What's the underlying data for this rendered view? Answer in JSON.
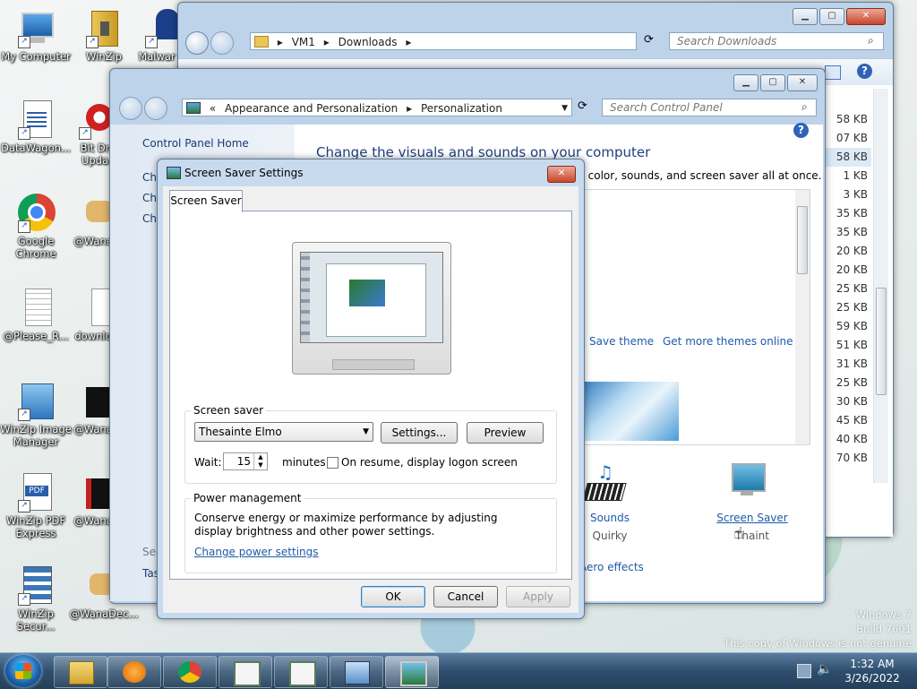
{
  "desktop": {
    "icons": [
      {
        "label": "My Computer"
      },
      {
        "label": "WinZip"
      },
      {
        "label": "Malwar"
      },
      {
        "label": "DataWagon..."
      },
      {
        "label": "Bit Dr Upda"
      },
      {
        "label": "Google Chrome"
      },
      {
        "label": "@Wana"
      },
      {
        "label": "@Please_R..."
      },
      {
        "label": "downlo"
      },
      {
        "label": "WinZip Image Manager"
      },
      {
        "label": "@Wana"
      },
      {
        "label": "WinZip PDF Express"
      },
      {
        "label": "@Wana"
      },
      {
        "label": "WinZip Secur..."
      },
      {
        "label": "@WanaDec..."
      }
    ],
    "watermark": {
      "line1": "Windows 7",
      "line2": "Build 7601",
      "line3": "This copy of Windows is not genuine"
    }
  },
  "explorer": {
    "address": [
      "VM1",
      "Downloads"
    ],
    "search_placeholder": "Search Downloads",
    "sizes": [
      "58 KB",
      "07 KB",
      "58 KB",
      "1 KB",
      "3 KB",
      "35 KB",
      "35 KB",
      "20 KB",
      "20 KB",
      "25 KB",
      "25 KB",
      "59 KB",
      "51 KB",
      "31 KB",
      "25 KB",
      "30 KB",
      "45 KB",
      "40 KB",
      "70 KB"
    ]
  },
  "control_panel": {
    "address_prefix": "«",
    "address": [
      "Appearance and Personalization",
      "Personalization"
    ],
    "search_placeholder": "Search Control Panel",
    "sidebar": {
      "home": "Control Panel Home",
      "items": [
        "Ch",
        "Ch",
        "Ch"
      ],
      "see_also": "See",
      "tas": "Tas"
    },
    "heading": "Change the visuals and sounds on your computer",
    "subheading": "w color, sounds, and screen saver all at once.",
    "save_theme": "Save theme",
    "get_more": "Get more themes online",
    "sounds_label": "Sounds",
    "sounds_value": "Quirky",
    "screensaver_label": "Screen Saver",
    "screensaver_value": "Thaint",
    "aero": "Aero effects"
  },
  "dialog": {
    "title": "Screen Saver Settings",
    "tab": "Screen Saver",
    "screen_saver_group": "Screen saver",
    "selected_saver": "Thesainte Elmo",
    "settings_button": "Settings...",
    "preview_button": "Preview",
    "wait_label": "Wait:",
    "wait_value": "15",
    "minutes_label": "minutes",
    "resume_label": "On resume, display logon screen",
    "power_group": "Power management",
    "power_text": "Conserve energy or maximize performance by adjusting display brightness and other power settings.",
    "power_link": "Change power settings",
    "ok": "OK",
    "cancel": "Cancel",
    "apply": "Apply"
  },
  "taskbar": {
    "time": "1:32 AM",
    "date": "3/26/2022"
  }
}
